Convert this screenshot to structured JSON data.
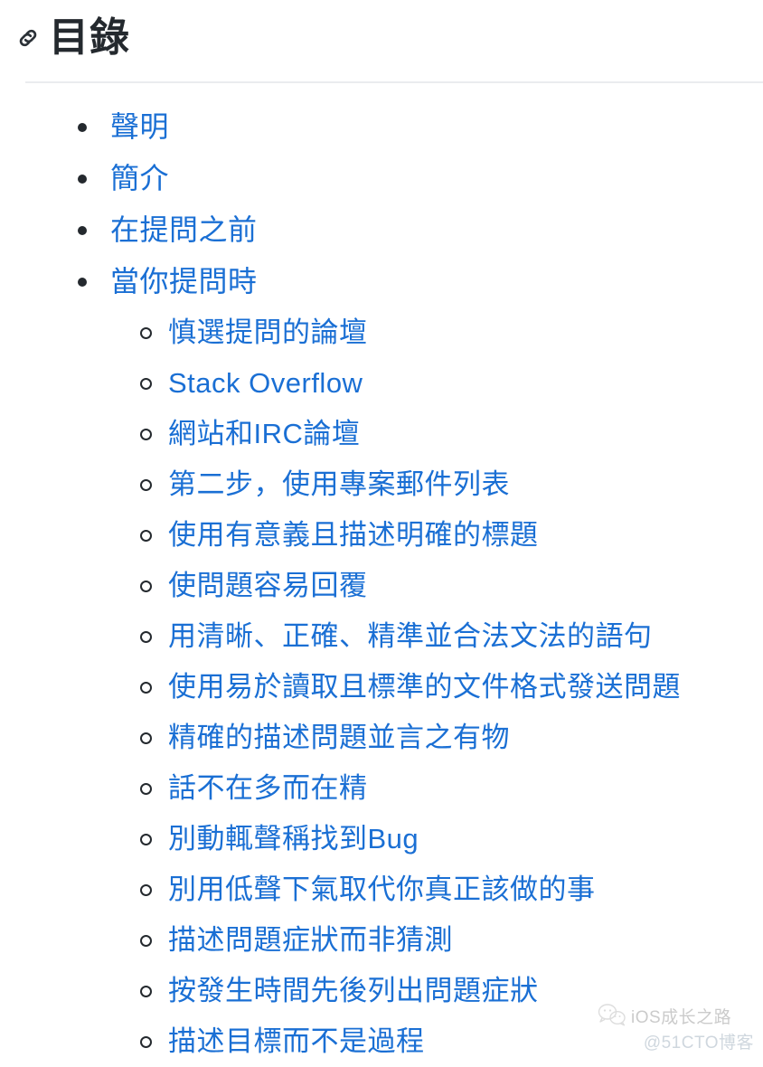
{
  "header": {
    "anchor_icon": "link-icon",
    "title": "目錄"
  },
  "toc": {
    "items": [
      {
        "label": "聲明",
        "children": []
      },
      {
        "label": "簡介",
        "children": []
      },
      {
        "label": "在提問之前",
        "children": []
      },
      {
        "label": "當你提問時",
        "children": [
          {
            "label": "慎選提問的論壇"
          },
          {
            "label": "Stack Overflow"
          },
          {
            "label": "網站和IRC論壇"
          },
          {
            "label": "第二步，使用專案郵件列表"
          },
          {
            "label": "使用有意義且描述明確的標題"
          },
          {
            "label": "使問題容易回覆"
          },
          {
            "label": "用清晰、正確、精準並合法文法的語句"
          },
          {
            "label": "使用易於讀取且標準的文件格式發送問題"
          },
          {
            "label": "精確的描述問題並言之有物"
          },
          {
            "label": "話不在多而在精"
          },
          {
            "label": "別動輒聲稱找到Bug"
          },
          {
            "label": "別用低聲下氣取代你真正該做的事"
          },
          {
            "label": "描述問題症狀而非猜測"
          },
          {
            "label": "按發生時間先後列出問題症狀"
          },
          {
            "label": "描述目標而不是過程"
          }
        ]
      }
    ]
  },
  "watermark": {
    "logo_icon": "wechat-icon",
    "brand": "iOS成长之路",
    "source": "@51CTO博客"
  },
  "colors": {
    "link": "#1a6fd4",
    "heading": "#24292e",
    "rule": "#eaecef",
    "background": "#ffffff",
    "watermark_brand": "#c9c9c9",
    "watermark_source": "#cdd5dd"
  }
}
